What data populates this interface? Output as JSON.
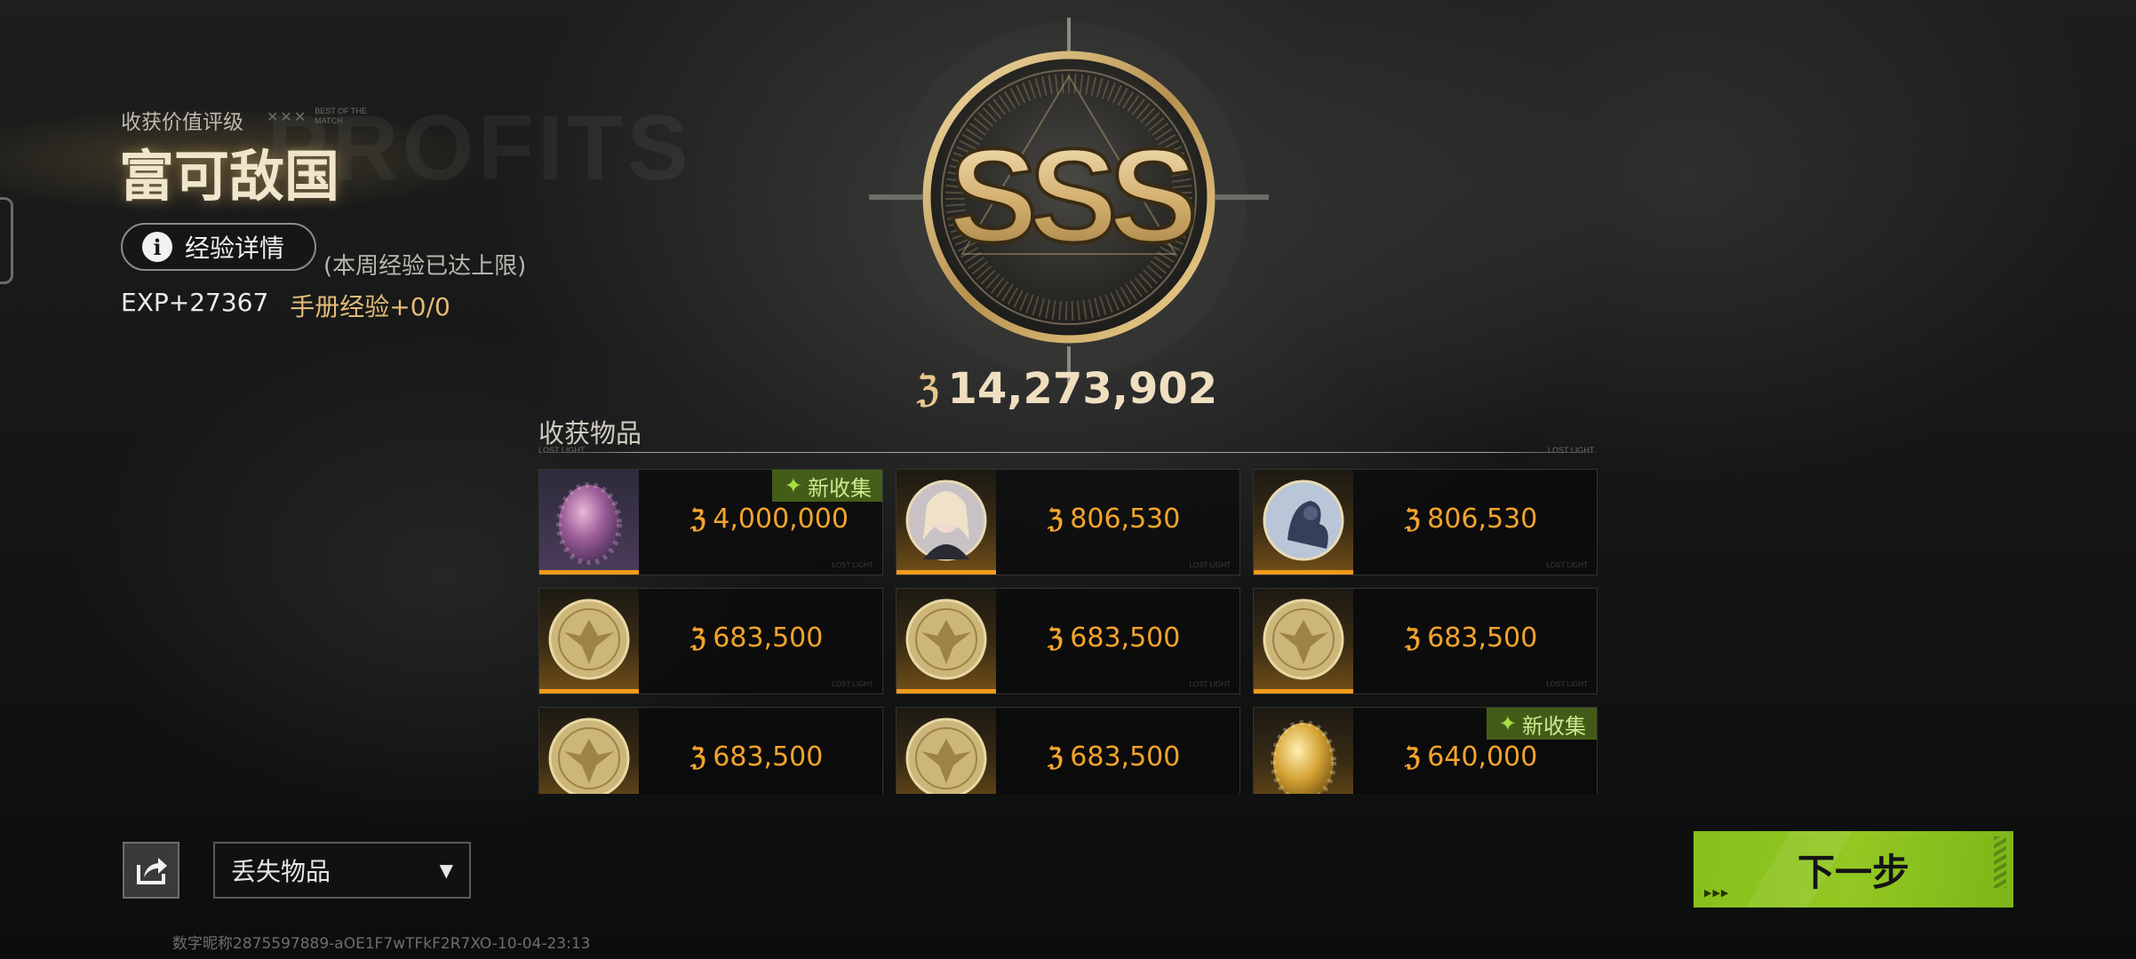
{
  "rating": {
    "label": "收获价值评级",
    "tag_marks": "✕✕✕",
    "tag_text": "BEST OF THE MATCH",
    "title": "富可敌国",
    "grade": "SSS",
    "watermark": "PROFITS"
  },
  "experience": {
    "details_button": "经验详情",
    "info_icon": "i",
    "weekly_limit_note": "(本周经验已达上限)",
    "exp_gain": "EXP+27367",
    "handbook_exp": "手册经验+0/0"
  },
  "total_value": {
    "coin_icon": "coin-icon",
    "coin_glyph": "ℨ",
    "amount": "14,273,902"
  },
  "items_section": {
    "title": "收获物品",
    "tag_left": "LOST LIGHT",
    "tag_right": "LOST LIGHT",
    "new_badge_label": "新收集",
    "items": [
      {
        "type": "egg-purple",
        "price": "4,000,000",
        "is_new": true
      },
      {
        "type": "portrait-girl",
        "price": "806,530",
        "is_new": false
      },
      {
        "type": "portrait-creature",
        "price": "806,530",
        "is_new": false
      },
      {
        "type": "gold-coin",
        "price": "683,500",
        "is_new": false
      },
      {
        "type": "gold-coin",
        "price": "683,500",
        "is_new": false
      },
      {
        "type": "gold-coin",
        "price": "683,500",
        "is_new": false
      },
      {
        "type": "gold-coin",
        "price": "683,500",
        "is_new": false
      },
      {
        "type": "gold-coin",
        "price": "683,500",
        "is_new": false
      },
      {
        "type": "egg-gold",
        "price": "640,000",
        "is_new": true
      }
    ]
  },
  "bottom": {
    "share_icon": "share-icon",
    "dropdown_value": "丢失物品",
    "next_button": "下一步",
    "footer_id": "数字昵称2875597889-aOE1F7wTFkF2R7XO-10-04-23:13"
  },
  "colors": {
    "accent_green": "#8cc41f",
    "price_orange": "#f3a42b",
    "gold": "#d9b877"
  }
}
